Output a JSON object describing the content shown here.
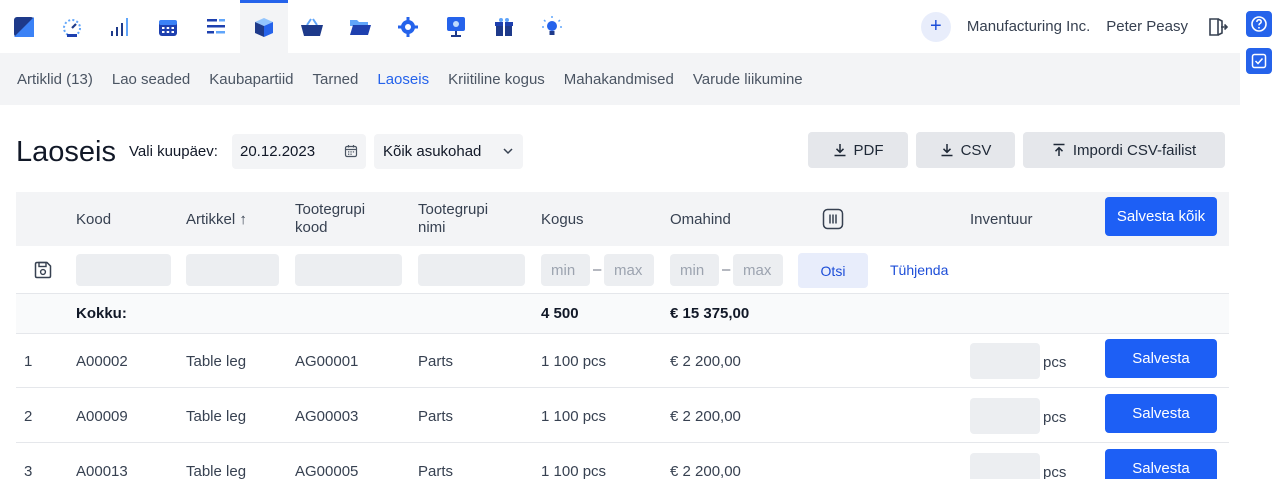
{
  "header": {
    "apps": [
      {
        "icon": "logo-icon",
        "active": false
      },
      {
        "icon": "dashboard-gauge-icon",
        "active": false
      },
      {
        "icon": "bar-chart-icon",
        "active": false
      },
      {
        "icon": "calendar-icon",
        "active": false
      },
      {
        "icon": "tasks-list-icon",
        "active": false
      },
      {
        "icon": "inventory-box-icon",
        "active": true
      },
      {
        "icon": "basket-icon",
        "active": false
      },
      {
        "icon": "folder-icon",
        "active": false
      },
      {
        "icon": "settings-gear-icon",
        "active": false
      },
      {
        "icon": "presentation-icon",
        "active": false
      },
      {
        "icon": "gift-icon",
        "active": false
      },
      {
        "icon": "lightbulb-icon",
        "active": false
      }
    ],
    "plus": "+",
    "company": "Manufacturing Inc.",
    "user": "Peter Peasy"
  },
  "subnav": {
    "tabs": [
      {
        "label": "Artiklid (13)",
        "active": false
      },
      {
        "label": "Lao seaded",
        "active": false
      },
      {
        "label": "Kaubapartiid",
        "active": false
      },
      {
        "label": "Tarned",
        "active": false
      },
      {
        "label": "Laoseis",
        "active": true
      },
      {
        "label": "Kriitiline kogus",
        "active": false
      },
      {
        "label": "Mahakandmised",
        "active": false
      },
      {
        "label": "Varude liikumine",
        "active": false
      }
    ]
  },
  "toolbar": {
    "title": "Laoseis",
    "date_label": "Vali kuupäev:",
    "date_value": "20.12.2023",
    "location": "Kõik asukohad",
    "pdf": "PDF",
    "csv": "CSV",
    "import": "Impordi CSV-failist"
  },
  "table": {
    "headers": {
      "kood": "Kood",
      "artikkel": "Artikkel ↑",
      "tootegrupi_kood_1": "Tootegrupi",
      "tootegrupi_kood_2": "kood",
      "tootegrupi_nimi_1": "Tootegrupi",
      "tootegrupi_nimi_2": "nimi",
      "kogus": "Kogus",
      "omahind": "Omahind",
      "inventuur": "Inventuur"
    },
    "save_all": "Salvesta kõik",
    "filter": {
      "min": "min",
      "max": "max",
      "dash": "–",
      "search": "Otsi",
      "clear": "Tühjenda"
    },
    "total": {
      "label": "Kokku:",
      "kogus": "4 500",
      "omahind": "€ 15 375,00"
    },
    "rows": [
      {
        "n": "1",
        "kood": "A00002",
        "artikkel": "Table leg",
        "grupi_kood": "AG00001",
        "grupi_nimi": "Parts",
        "kogus": "1 100 pcs",
        "omahind": "€ 2 200,00",
        "unit": "pcs",
        "save": "Salvesta"
      },
      {
        "n": "2",
        "kood": "A00009",
        "artikkel": "Table leg",
        "grupi_kood": "AG00003",
        "grupi_nimi": "Parts",
        "kogus": "1 100 pcs",
        "omahind": "€ 2 200,00",
        "unit": "pcs",
        "save": "Salvesta"
      },
      {
        "n": "3",
        "kood": "A00013",
        "artikkel": "Table leg",
        "grupi_kood": "AG00005",
        "grupi_nimi": "Parts",
        "kogus": "1 100 pcs",
        "omahind": "€ 2 200,00",
        "unit": "pcs",
        "save": "Salvesta"
      }
    ]
  },
  "colors": {
    "accent": "#2563eb",
    "button": "#1d5ff5",
    "panel": "#f3f4f6"
  }
}
